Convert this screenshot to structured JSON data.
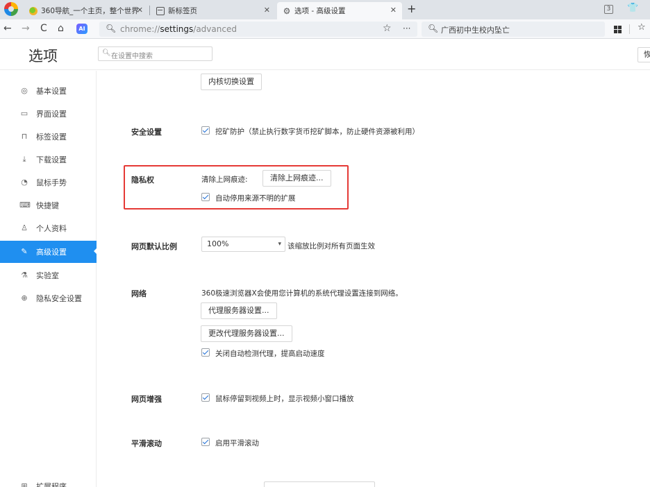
{
  "tabs": [
    {
      "title": "360导航_一个主页，整个世界",
      "favicon": "360-nav-icon"
    },
    {
      "title": "新标签页",
      "favicon": "new-tab-page-icon"
    },
    {
      "title": "选项 - 高级设置",
      "favicon": "gear-icon",
      "active": true
    }
  ],
  "window": {
    "badge": "3"
  },
  "toolbar": {
    "url_prefix": "chrome://",
    "url_host": "settings",
    "url_path": "/advanced",
    "search_text": "广西初中生校内坠亡"
  },
  "header": {
    "title": "选项",
    "search_placeholder": "在设置中搜索",
    "right_button_label": "恢"
  },
  "sidebar": {
    "items": [
      {
        "label": "基本设置",
        "icon": "basic-settings-icon"
      },
      {
        "label": "界面设置",
        "icon": "interface-icon"
      },
      {
        "label": "标签设置",
        "icon": "tabs-icon"
      },
      {
        "label": "下载设置",
        "icon": "download-icon"
      },
      {
        "label": "鼠标手势",
        "icon": "mouse-icon"
      },
      {
        "label": "快捷键",
        "icon": "keyboard-icon"
      },
      {
        "label": "个人资料",
        "icon": "user-icon"
      },
      {
        "label": "高级设置",
        "icon": "advanced-icon",
        "active": true
      },
      {
        "label": "实验室",
        "icon": "lab-icon"
      },
      {
        "label": "隐私安全设置",
        "icon": "privacy-icon"
      },
      {
        "label": "扩展程序",
        "icon": "extensions-icon"
      }
    ]
  },
  "main": {
    "kernel_button": "内核切换设置",
    "security": {
      "label": "安全设置",
      "checkbox": "挖矿防护（禁止执行数字货币挖矿脚本，防止硬件资源被利用）",
      "checked": true
    },
    "privacy": {
      "label": "隐私权",
      "clear_label": "清除上网痕迹:",
      "clear_button": "清除上网痕迹...",
      "checkbox": "自动停用来源不明的扩展",
      "checked": true
    },
    "zoom": {
      "label": "网页默认比例",
      "value": "100%",
      "note": "该缩放比例对所有页面生效"
    },
    "network": {
      "label": "网络",
      "description": "360极速浏览器X会使用您计算机的系统代理设置连接到网络。",
      "proxy_button": "代理服务器设置...",
      "change_proxy_button": "更改代理服务器设置...",
      "checkbox": "关闭自动检测代理，提高启动速度",
      "checked": true
    },
    "enhance": {
      "label": "网页增强",
      "checkbox": "鼠标停留到视频上时，显示视频小窗口播放",
      "checked": true
    },
    "smooth": {
      "label": "平滑滚动",
      "checkbox": "启用平滑滚动",
      "checked": true
    }
  },
  "colors": {
    "accent": "#1f8ff0",
    "highlight_border": "#e53935"
  }
}
